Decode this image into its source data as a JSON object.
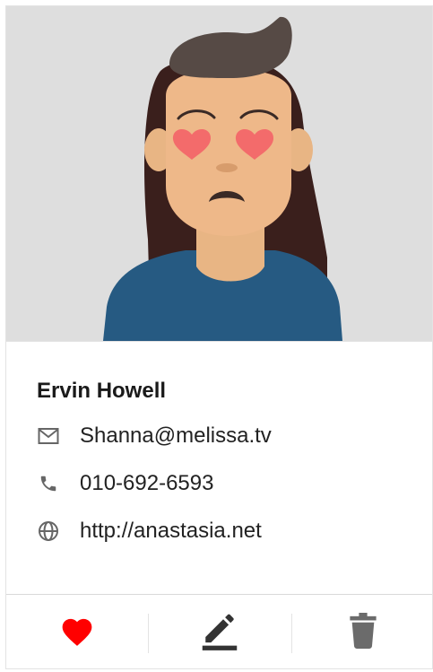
{
  "profile": {
    "name": "Ervin Howell",
    "email": "Shanna@melissa.tv",
    "phone": "010-692-6593",
    "website": "http://anastasia.net"
  },
  "icons": {
    "email": "mail-icon",
    "phone": "phone-icon",
    "website": "globe-icon",
    "like": "heart-icon",
    "edit": "edit-icon",
    "delete": "trash-icon"
  },
  "colors": {
    "heart": "#ff0000",
    "icon_gray": "#666666",
    "edit_icon": "#333333",
    "delete_icon": "#6b6b6b",
    "avatar_bg": "#dedede"
  }
}
